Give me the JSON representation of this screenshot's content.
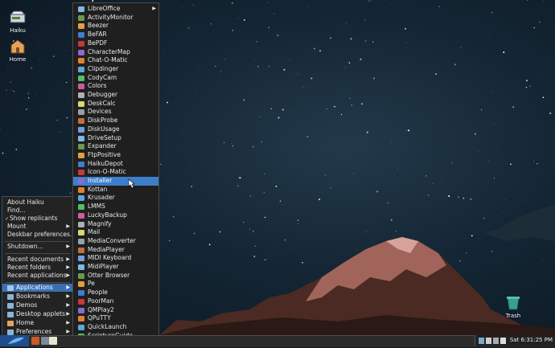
{
  "desktop": {
    "icons": [
      {
        "label": "Haiku",
        "icon": "drive-icon"
      },
      {
        "label": "Home",
        "icon": "home-folder-icon"
      },
      {
        "label": "Trash",
        "icon": "trash-icon"
      }
    ]
  },
  "leaf_menu": {
    "items": [
      {
        "label": "About Haiku"
      },
      {
        "label": "Find..."
      },
      {
        "label": "Show replicants",
        "checked": true
      },
      {
        "label": "Mount",
        "submenu": true
      },
      {
        "label": "Deskbar preferences..."
      },
      {
        "label": "Shutdown...",
        "submenu": true
      },
      {
        "label": "Recent documents",
        "submenu": true
      },
      {
        "label": "Recent folders",
        "submenu": true
      },
      {
        "label": "Recent applications",
        "submenu": true
      },
      {
        "label": "Applications",
        "submenu": true,
        "selected": true
      },
      {
        "label": "Bookmarks",
        "submenu": true
      },
      {
        "label": "Demos",
        "submenu": true
      },
      {
        "label": "Desktop applets",
        "submenu": true
      },
      {
        "label": "Home",
        "submenu": true
      },
      {
        "label": "Preferences",
        "submenu": true
      }
    ]
  },
  "applications_menu": {
    "items": [
      "LibreOffice",
      "ActivityMonitor",
      "Beezer",
      "BeFAR",
      "BePDF",
      "CharacterMap",
      "Chat-O-Matic",
      "Clipdinger",
      "CodyCam",
      "Colors",
      "Debugger",
      "DeskCalc",
      "Devices",
      "DiskProbe",
      "DiskUsage",
      "DriveSetup",
      "Expander",
      "FtpPositive",
      "HaikuDepot",
      "Icon-O-Matic",
      "Installer",
      "Kottan",
      "Krusader",
      "LMMS",
      "LuckyBackup",
      "Magnify",
      "Mail",
      "MediaConverter",
      "MediaPlayer",
      "MIDI Keyboard",
      "MidiPlayer",
      "Otter Browser",
      "Pe",
      "People",
      "PoorMan",
      "QMPlay2",
      "QPuTTY",
      "QuickLaunch",
      "ScriptureGuide"
    ],
    "selected": "Installer",
    "submenu_item": "LibreOffice"
  },
  "deskbar": {
    "clock": "Sat 6:31:25 PM"
  },
  "colors": {
    "menu_bg": "#1f1f1f",
    "selection": "#3d7ec8",
    "deskbar_bg": "#2b2b2b"
  }
}
